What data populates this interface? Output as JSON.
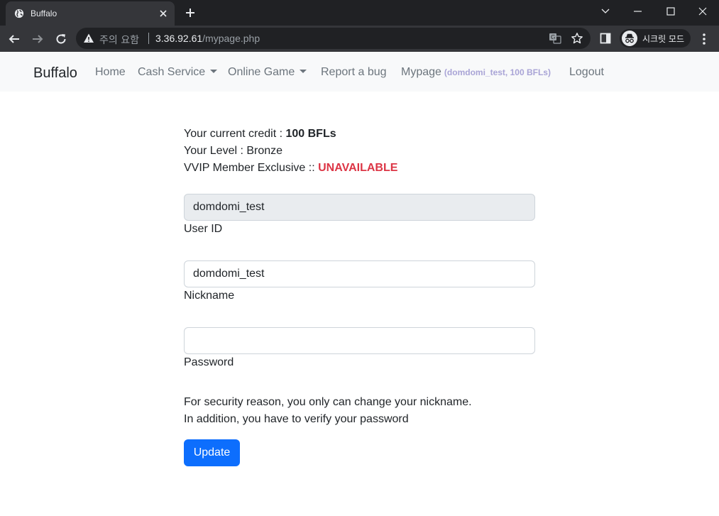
{
  "browser": {
    "tab_title": "Buffalo",
    "security_label": "주의 요함",
    "url_host": "3.36.92.61",
    "url_path": "/mypage.php",
    "incognito_label": "시크릿 모드"
  },
  "navbar": {
    "brand": "Buffalo",
    "home": "Home",
    "cash_service": "Cash Service",
    "online_game": "Online Game",
    "report_bug": "Report a bug",
    "mypage": "Mypage",
    "mypage_detail": "(domdomi_test, 100 BFLs)",
    "logout": "Logout"
  },
  "info": {
    "credit_label": "Your current credit : ",
    "credit_value": "100 BFLs",
    "level_line": "Your Level : Bronze",
    "vvip_label": "VVIP Member Exclusive :: ",
    "vvip_status": "UNAVAILABLE"
  },
  "form": {
    "user_id_value": "domdomi_test",
    "user_id_label": "User ID",
    "nickname_value": "domdomi_test",
    "nickname_label": "Nickname",
    "password_value": "",
    "password_label": "Password",
    "note_line1": "For security reason, you only can change your nickname.",
    "note_line2": "In addition, you have to verify your password",
    "update_label": "Update"
  },
  "colors": {
    "primary": "#0d6efd",
    "danger": "#dc3545",
    "navbar_bg": "#f8f9fa",
    "chrome_dark": "#202124"
  }
}
